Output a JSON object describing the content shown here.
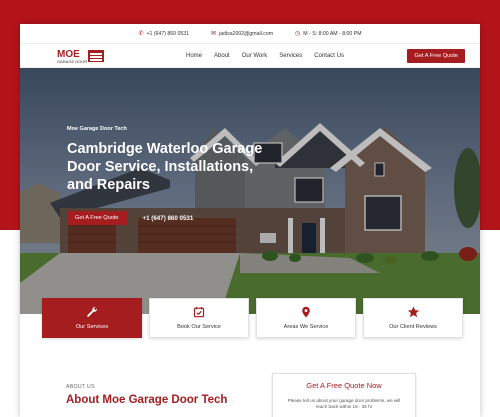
{
  "topbar": {
    "phone": "+1 (647) 860 0531",
    "email": "jadisa2002@gmail.com",
    "hours": "M - S: 8:00 AM - 8:00 PM"
  },
  "logo": {
    "name": "MOE",
    "tagline": "GARAGE DOOR"
  },
  "nav": {
    "links": [
      "Home",
      "About",
      "Our Work",
      "Services",
      "Contact Us"
    ],
    "cta": "Get A Free Quote"
  },
  "hero": {
    "eyebrow": "Moe Garage Door Tech",
    "title": "Cambridge Waterloo Garage Door Service, Installations, and Repairs",
    "cta": "Get A Free Quote",
    "phone": "+1 (647) 860 0531"
  },
  "cards": [
    {
      "label": "Our Services",
      "icon": "wrench-icon"
    },
    {
      "label": "Book Our Service",
      "icon": "calendar-check-icon"
    },
    {
      "label": "Areas We Service",
      "icon": "map-pin-icon"
    },
    {
      "label": "Our Client Reviews",
      "icon": "star-icon"
    }
  ],
  "about": {
    "eyebrow": "ABOUT US",
    "title": "About Moe Garage Door Tech"
  },
  "quote": {
    "title": "Get A Free Quote Now",
    "text": "Please tell us about your garage door problems, we will reach back within 15 - 35 hr"
  },
  "colors": {
    "brand": "#a51d1f",
    "background": "#b3141a"
  }
}
